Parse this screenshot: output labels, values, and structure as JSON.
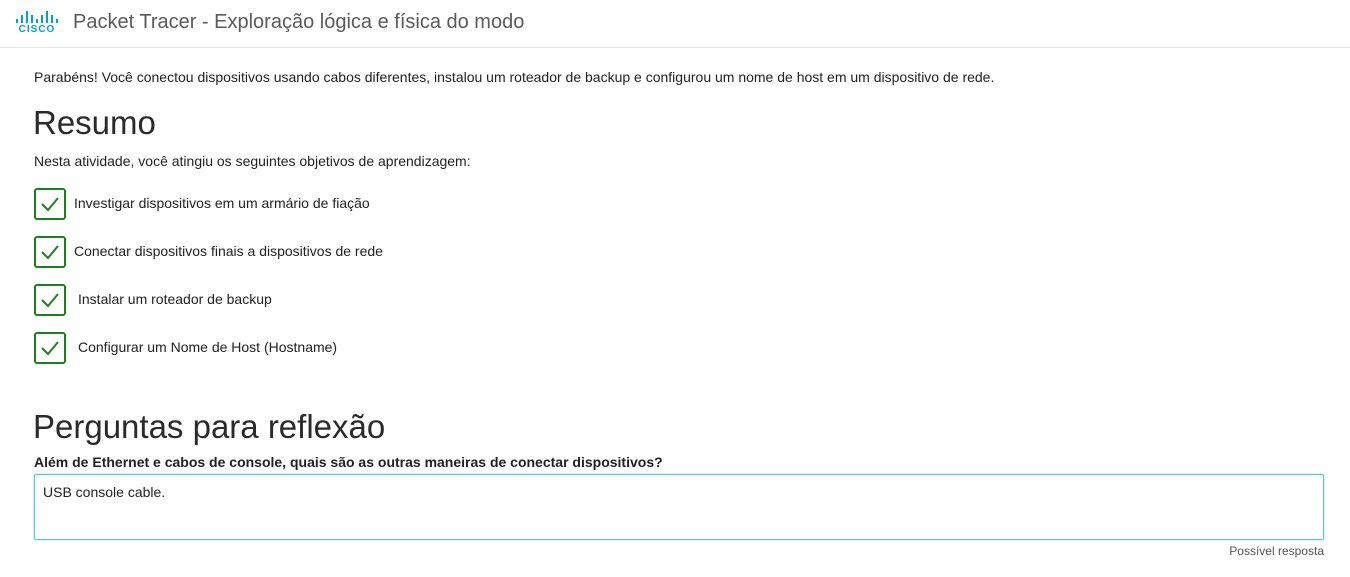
{
  "header": {
    "logo_text": "CISCO",
    "title": "Packet Tracer - Exploração lógica e física do modo",
    "brand_color": "#049fd9"
  },
  "intro_text": "Parabéns! Você conectou dispositivos usando cabos diferentes, instalou um roteador de backup e configurou um nome de host em um dispositivo de rede.",
  "summary": {
    "heading": "Resumo",
    "subtitle": "Nesta atividade, você atingiu os seguintes objetivos de aprendizagem:",
    "objectives": [
      {
        "label": "Investigar dispositivos em um armário de fiação",
        "checked": true,
        "icon": "check-icon"
      },
      {
        "label": "Conectar dispositivos finais a dispositivos de rede",
        "checked": true,
        "icon": "check-icon"
      },
      {
        "label": "Instalar um roteador de backup",
        "checked": true,
        "icon": "check-icon"
      },
      {
        "label": "Configurar um Nome de Host (Hostname)",
        "checked": true,
        "icon": "check-icon"
      }
    ],
    "check_color": "#1d7f1d"
  },
  "reflection": {
    "heading": "Perguntas para reflexão",
    "question": "Além de Ethernet e cabos de console, quais são as outras maneiras de conectar dispositivos?",
    "answer": "USB console cable.",
    "possible_answer_label": "Possível resposta"
  }
}
